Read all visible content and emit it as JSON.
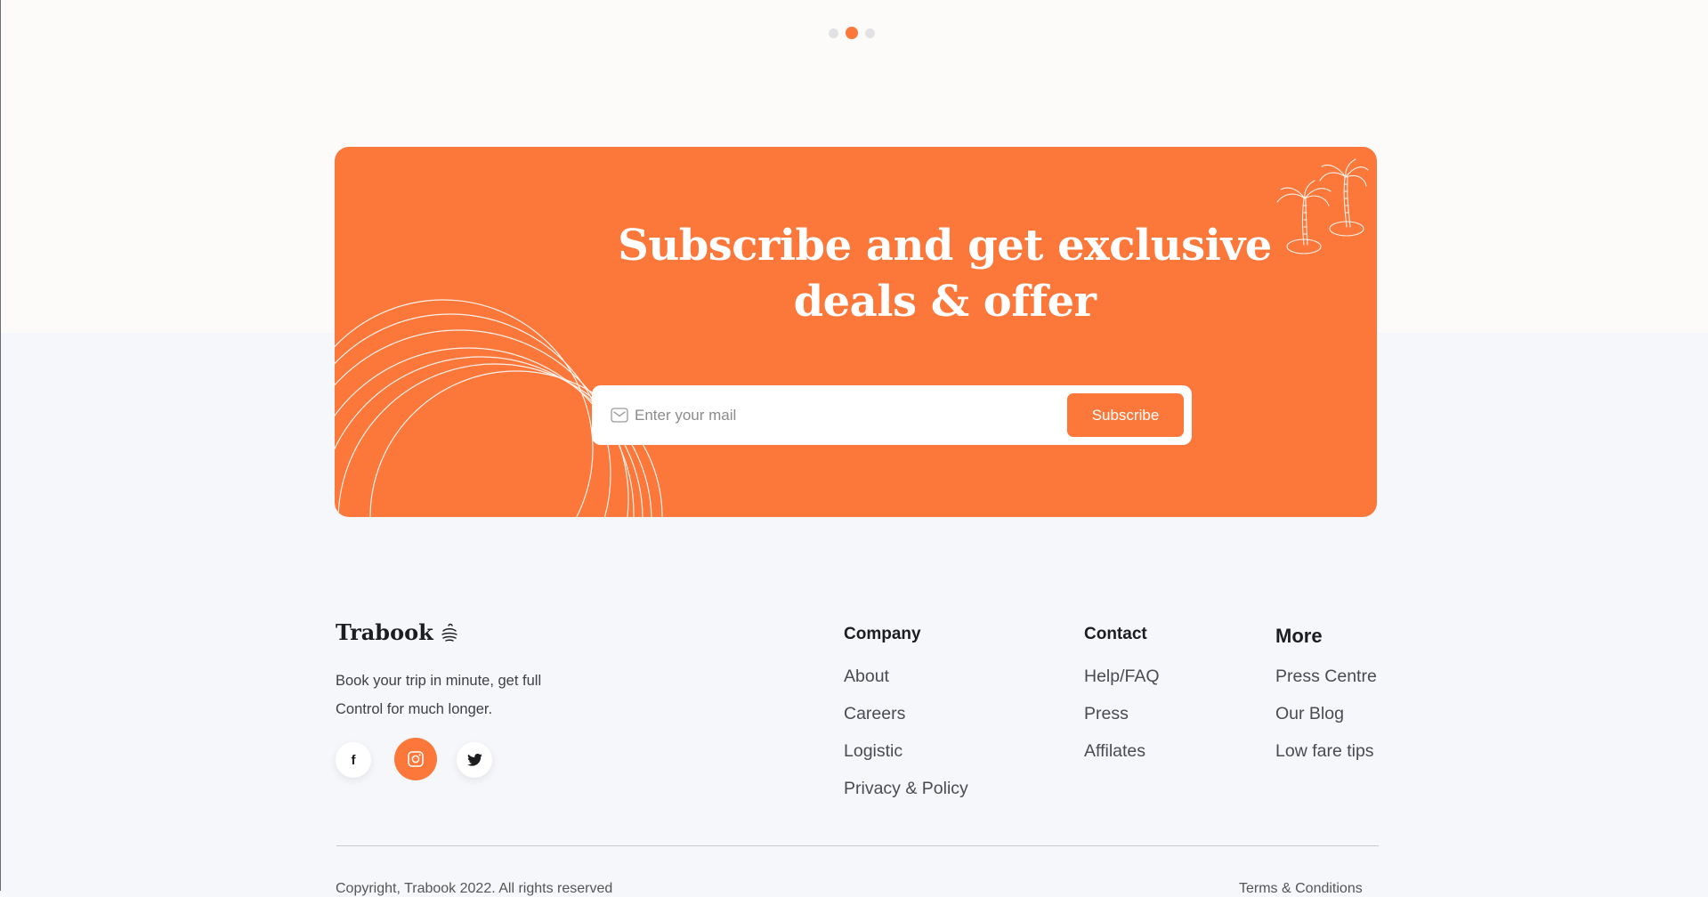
{
  "carousel": {
    "dots": 3,
    "active_index": 1
  },
  "subscribe": {
    "title_line1": "Subscribe and get exclusive",
    "title_line2": "deals & offer",
    "email_placeholder": "Enter your mail",
    "button_label": "Subscribe"
  },
  "footer": {
    "brand_name": "Trabook",
    "tagline_line1": "Book your trip in minute, get full",
    "tagline_line2": "Control for much longer.",
    "socials": [
      {
        "name": "facebook",
        "glyph": "f"
      },
      {
        "name": "instagram",
        "glyph": "instagram-icon"
      },
      {
        "name": "twitter",
        "glyph": "twitter-icon"
      }
    ],
    "columns": [
      {
        "heading": "Company",
        "links": [
          "About",
          "Careers",
          "Logistic",
          "Privacy & Policy"
        ]
      },
      {
        "heading": "Contact",
        "links": [
          "Help/FAQ",
          "Press",
          "Affilates"
        ]
      },
      {
        "heading": "More",
        "links": [
          "Press Centre",
          "Our Blog",
          "Low fare tips"
        ]
      }
    ],
    "copyright": "Copyright, Trabook 2022. All rights reserved",
    "terms": "Terms & Conditions"
  },
  "colors": {
    "accent": "#fb773a",
    "page_background": "#f6f7fa",
    "top_background": "#fcfbfa",
    "text_dark": "#1d1d1f"
  }
}
